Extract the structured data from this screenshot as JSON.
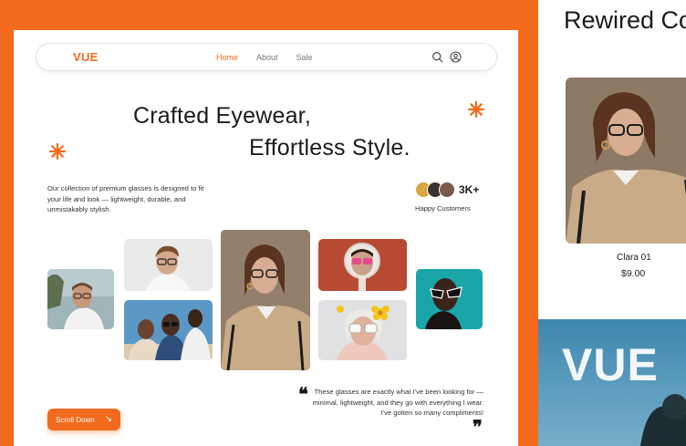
{
  "nav": {
    "logo": "VUE",
    "links": [
      "Home",
      "About",
      "Sale"
    ],
    "active_link": "Home",
    "icons": [
      "search-icon",
      "user-icon"
    ]
  },
  "hero": {
    "headline_line1": "Crafted Eyewear,",
    "headline_line2": "Effortless Style.",
    "description": "Our collection of premium glasses is designed to fit your life and look — lightweight, durable, and unmistakably stylish.",
    "customers_count": "3K+",
    "customers_label": "Happy Customers",
    "quote": "These glasses are exactly what I've been looking for — minimal, lightweight, and they go with everything I wear. I've gotten so many compliments!",
    "scroll_button": "Scroll Down"
  },
  "side": {
    "title": "Rewired Co",
    "product_name": "Clara 01",
    "product_price": "$9.00",
    "banner_logo": "VUE"
  },
  "colors": {
    "accent": "#F26A1B",
    "text": "#1b1b1b",
    "background": "#ffffff"
  }
}
